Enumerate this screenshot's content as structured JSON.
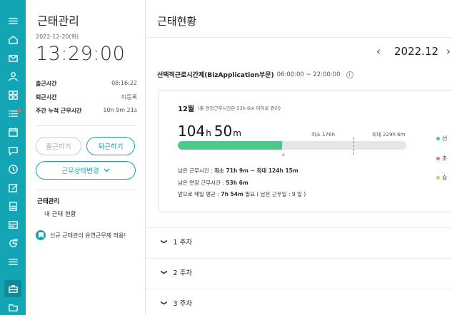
{
  "rail": {
    "icons": [
      "menu-icon",
      "home-icon",
      "mail-icon",
      "person-icon",
      "grid-icon",
      "list-icon",
      "calendar-icon",
      "chat-icon",
      "clock-icon",
      "edit-icon",
      "document-icon",
      "form-icon",
      "chart-icon",
      "stack-icon",
      "briefcase-icon",
      "folder-icon"
    ],
    "active": "briefcase-icon",
    "colors": {
      "background": "#14a5b5",
      "active": "#0d8b99",
      "badge": "#ff5a5a"
    }
  },
  "sidebar": {
    "title": "근태관리",
    "date": "2022-12-20(화)",
    "clock": "13:29:00",
    "stats": [
      {
        "label": "출근시간",
        "value": "08:16:22"
      },
      {
        "label": "퇴근시간",
        "value": "미등록"
      },
      {
        "label": "주간 누적 근무시간",
        "value": "10h 9m 21s"
      }
    ],
    "clock_in_label": "출근하기",
    "clock_out_label": "퇴근하기",
    "status_change_label": "근무상태변경",
    "menu_header": "근태관리",
    "menu_item": "내 근태 현황",
    "notice": "신규 근태관리 유연근무제 적용!"
  },
  "main": {
    "title": "근태현황",
    "month": "2022.12",
    "policy_name": "선택적근로시간제(BizApplication부문)",
    "policy_time": "06:00:00 ~ 22:00:00",
    "card": {
      "month": "12월",
      "month_note": "(총 연장근무시간은 53h 6m 이하로 관리)",
      "hours": "104",
      "hours_unit": "h",
      "minutes": "50",
      "minutes_unit": "m",
      "min_label": "최소 176h",
      "max_label": "최대 229h 6m",
      "progress_hours": 104.83,
      "min_hours": 176,
      "max_hours": 229.1,
      "remaining_label": "남은 근무시간 :",
      "remaining_value": "최소 71h 9m ~ 최대 124h 15m",
      "overtime_label": "남은 연장 근무시간 :",
      "overtime_value": "53h 6m",
      "daily_prefix": "앞으로 매일 평균 :",
      "daily_value": "7h 54m",
      "daily_suffix": "필요 ( 남은 근무일 : 9 일 )",
      "legend": [
        {
          "label": "선",
          "color": "#4bc98a"
        },
        {
          "label": "초",
          "color": "#f07070"
        },
        {
          "label": "승",
          "color": "#f5c342"
        }
      ]
    },
    "weeks": [
      "1 주차",
      "2 주차",
      "3 주차"
    ]
  }
}
